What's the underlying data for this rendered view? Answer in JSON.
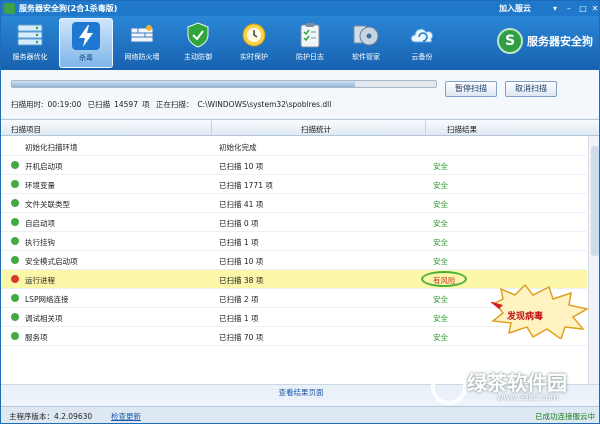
{
  "window": {
    "title": "服务器安全狗(2合1杀毒版)",
    "join_label": "加入服云"
  },
  "toolbar": {
    "items": [
      {
        "label": "服务器优化",
        "icon": "server-rack-icon",
        "color": "#8cc4f0"
      },
      {
        "label": "杀毒",
        "icon": "lightning-shield-icon",
        "color": "#1e78d2",
        "active": true
      },
      {
        "label": "网络防火墙",
        "icon": "network-wall-icon",
        "color": "#3aa0e8"
      },
      {
        "label": "主动防御",
        "icon": "green-shield-icon",
        "color": "#2fa53c"
      },
      {
        "label": "实时保护",
        "icon": "clock-icon",
        "color": "#f0c21a"
      },
      {
        "label": "防护日志",
        "icon": "clipboard-icon",
        "color": "#e7eef6"
      },
      {
        "label": "软件管家",
        "icon": "disc-icon",
        "color": "#b8c7d8"
      },
      {
        "label": "云备份",
        "icon": "cloud-backup-icon",
        "color": "#3f9be0"
      }
    ],
    "brand_name": "服务器安全狗",
    "brand_letter": "S"
  },
  "scan": {
    "progress": 0.81,
    "time_label": "扫描用时:",
    "time_value": "00:19:00",
    "scanned_label": "已扫描",
    "scanned_count": "14597",
    "scanned_unit": "项",
    "current_label": "正在扫描：",
    "current_path": "C:\\WINDOWS\\system32\\spoblres.dll",
    "pause_button": "暂停扫描",
    "cancel_button": "取消扫描"
  },
  "table": {
    "headers": [
      "扫描项目",
      "扫描统计",
      "扫描结果"
    ],
    "rows": [
      {
        "item": "初始化扫描环境",
        "stat": "初始化完成",
        "result": "",
        "status": "none"
      },
      {
        "item": "开机启动项",
        "stat": "已扫描 10 项",
        "result": "安全",
        "status": "ok"
      },
      {
        "item": "环境变量",
        "stat": "已扫描 1771 项",
        "result": "安全",
        "status": "ok"
      },
      {
        "item": "文件关联类型",
        "stat": "已扫描 41 项",
        "result": "安全",
        "status": "ok"
      },
      {
        "item": "自启动项",
        "stat": "已扫描 0 项",
        "result": "安全",
        "status": "ok"
      },
      {
        "item": "执行挂钩",
        "stat": "已扫描 1 项",
        "result": "安全",
        "status": "ok"
      },
      {
        "item": "安全模式启动项",
        "stat": "已扫描 10 项",
        "result": "安全",
        "status": "ok"
      },
      {
        "item": "运行进程",
        "stat": "已扫描 38 项",
        "result": "有风险",
        "status": "risk"
      },
      {
        "item": "LSP网络连接",
        "stat": "已扫描 2 项",
        "result": "安全",
        "status": "ok"
      },
      {
        "item": "调试相关项",
        "stat": "已扫描 1 项",
        "result": "安全",
        "status": "ok"
      },
      {
        "item": "服务项",
        "stat": "已扫描 70 项",
        "result": "安全",
        "status": "ok"
      }
    ],
    "view_link": "查看结果页面"
  },
  "callout": {
    "text": "发现病毒"
  },
  "footer": {
    "version_label": "主程序版本：",
    "version": "4.2.09630",
    "update_link": "检查更新",
    "connection_status": "已成功连接服云中"
  },
  "watermark": {
    "title": "绿茶软件园",
    "url": "www.33LC.com"
  },
  "colors": {
    "accent": "#1f78c9",
    "ok": "#2a9a2a",
    "risk": "#c03030",
    "highlight": "#fbf6a8"
  }
}
